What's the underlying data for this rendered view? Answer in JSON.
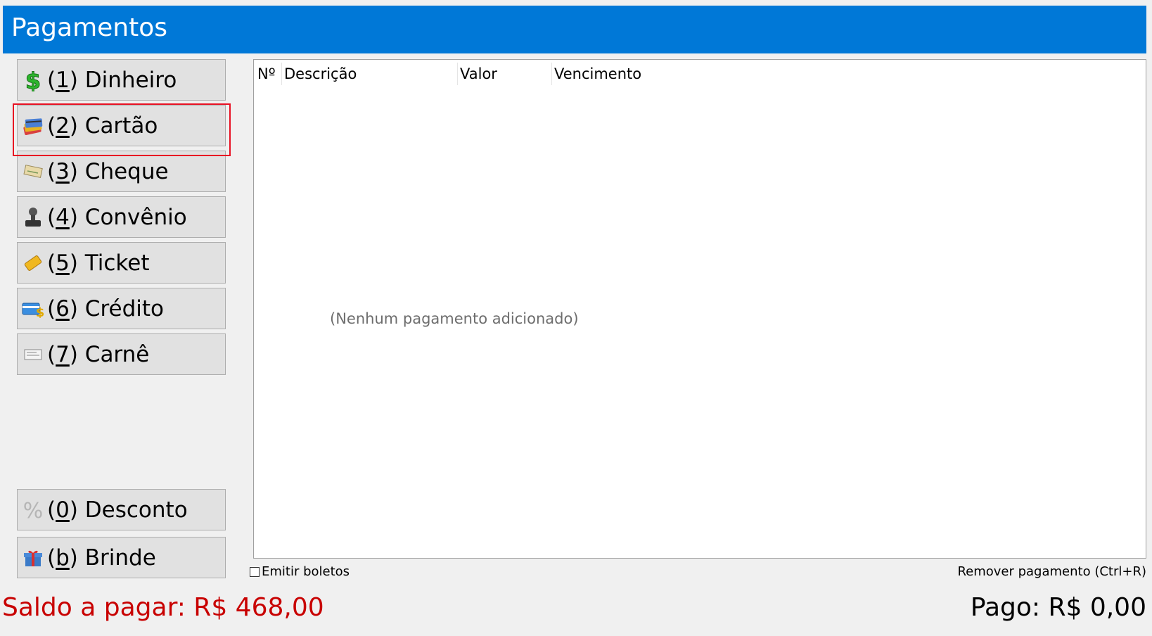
{
  "window": {
    "title": "Pagamentos"
  },
  "payment_buttons": [
    {
      "prefix": "(",
      "key": "1",
      "suffix": ") Dinheiro",
      "icon": "dollar-icon"
    },
    {
      "prefix": "(",
      "key": "2",
      "suffix": ") Cartão",
      "icon": "cards-icon"
    },
    {
      "prefix": "(",
      "key": "3",
      "suffix": ") Cheque",
      "icon": "cheque-icon"
    },
    {
      "prefix": "(",
      "key": "4",
      "suffix": ") Convênio",
      "icon": "stamp-icon"
    },
    {
      "prefix": "(",
      "key": "5",
      "suffix": ") Ticket",
      "icon": "ticket-icon"
    },
    {
      "prefix": "(",
      "key": "6",
      "suffix": ") Crédito",
      "icon": "credit-card-icon"
    },
    {
      "prefix": "(",
      "key": "7",
      "suffix": ") Carnê",
      "icon": "booklet-icon"
    },
    {
      "prefix": "(",
      "key": "0",
      "suffix": ") Desconto",
      "icon": "percent-icon"
    },
    {
      "prefix": "(",
      "key": "b",
      "suffix": ") Brinde",
      "icon": "gift-icon"
    }
  ],
  "table": {
    "columns": [
      "Nº",
      "Descrição",
      "Valor",
      "Vencimento"
    ],
    "rows": [],
    "empty_message": "(Nenhum pagamento adicionado)"
  },
  "footer": {
    "emitir_boletos_label": "Emitir boletos",
    "emitir_boletos_checked": false,
    "remove_link": "Remover pagamento (Ctrl+R)",
    "saldo": "Saldo a pagar: R$ 468,00",
    "pago": "Pago: R$ 0,00"
  },
  "colors": {
    "titlebar": "#0078d7",
    "saldo_text": "#c80000",
    "highlight": "#e81123"
  }
}
